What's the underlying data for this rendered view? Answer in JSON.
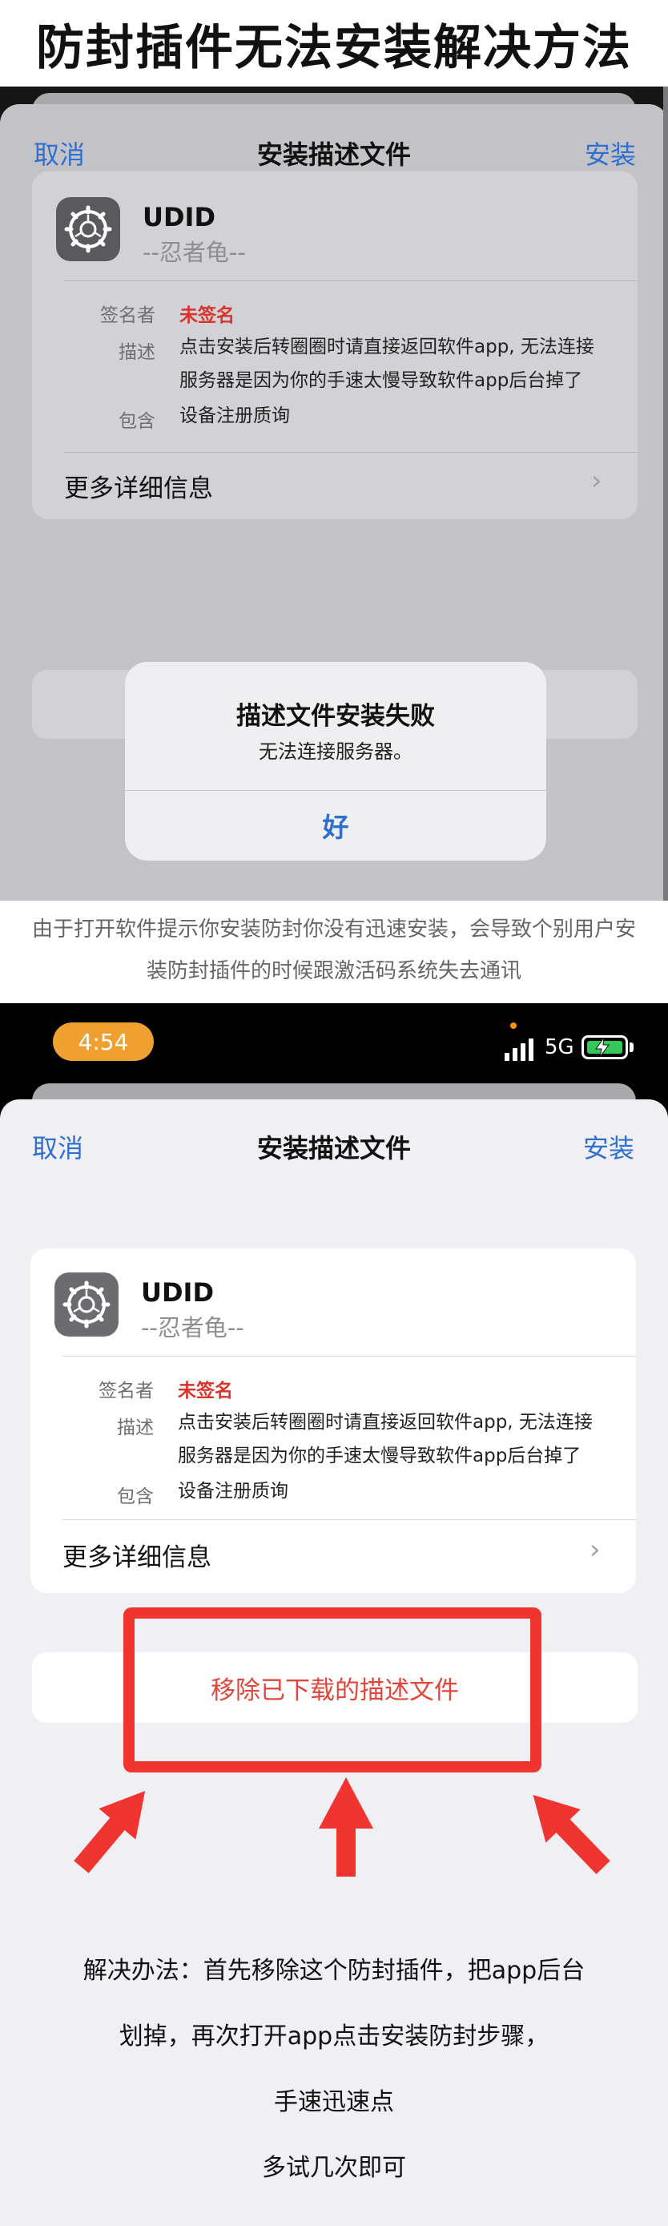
{
  "header": {
    "title": "防封插件无法安装解决方法"
  },
  "screen1": {
    "nav": {
      "cancel": "取消",
      "title": "安装描述文件",
      "install": "安装"
    },
    "profile": {
      "name": "UDID",
      "subtitle": "--忍者龟--",
      "signer_label": "签名者",
      "signer_value": "未签名",
      "desc_label": "描述",
      "desc_line1": "点击安装后转圈圈时请直接返回软件app, 无法连接",
      "desc_line2": "服务器是因为你的手速太慢导致软件app后台掉了",
      "contains_label": "包含",
      "contains_value": "设备注册质询",
      "more_details": "更多详细信息"
    },
    "alert": {
      "title": "描述文件安装失败",
      "message": "无法连接服务器。",
      "ok": "好"
    }
  },
  "caption": {
    "line1": "由于打开软件提示你安装防封你没有迅速安装，会导致个别用户安",
    "line2": "装防封插件的时候跟激活码系统失去通讯"
  },
  "screen2": {
    "status": {
      "time": "4:54",
      "network": "5G"
    },
    "nav": {
      "cancel": "取消",
      "title": "安装描述文件",
      "install": "安装"
    },
    "profile": {
      "name": "UDID",
      "subtitle": "--忍者龟--",
      "signer_label": "签名者",
      "signer_value": "未签名",
      "desc_label": "描述",
      "desc_line1": "点击安装后转圈圈时请直接返回软件app, 无法连接",
      "desc_line2": "服务器是因为你的手速太慢导致软件app后台掉了",
      "contains_label": "包含",
      "contains_value": "设备注册质询",
      "more_details": "更多详细信息"
    },
    "remove_button": "移除已下载的描述文件"
  },
  "solution": {
    "line1": "解决办法：首先移除这个防封插件，把app后台",
    "line2": "划掉，再次打开app点击安装防封步骤，",
    "line3": "手速迅速点",
    "line4": "多试几次即可"
  },
  "colors": {
    "ios_blue": "#2f6fcf",
    "unsigned_red": "#d8342b",
    "highlight_red": "#f0342f",
    "time_pill": "#f0a030"
  },
  "icons": [
    "gear-icon",
    "chevron-right-icon",
    "signal-icon",
    "battery-charging-icon",
    "arrow-up-icon"
  ]
}
